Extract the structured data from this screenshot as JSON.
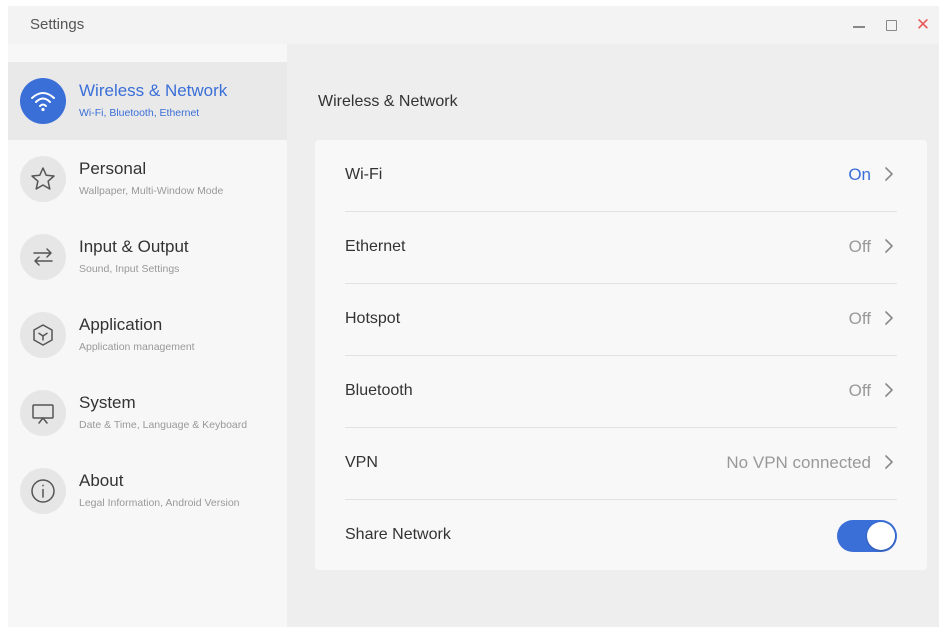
{
  "window": {
    "title": "Settings"
  },
  "sidebar": {
    "items": [
      {
        "title": "Wireless & Network",
        "subtitle": "Wi-Fi, Bluetooth, Ethernet",
        "icon": "wifi-icon",
        "active": true
      },
      {
        "title": "Personal",
        "subtitle": "Wallpaper, Multi-Window Mode",
        "icon": "star-icon",
        "active": false
      },
      {
        "title": "Input & Output",
        "subtitle": "Sound, Input Settings",
        "icon": "swap-arrows-icon",
        "active": false
      },
      {
        "title": "Application",
        "subtitle": "Application management",
        "icon": "cube-icon",
        "active": false
      },
      {
        "title": "System",
        "subtitle": "Date & Time, Language & Keyboard",
        "icon": "monitor-icon",
        "active": false
      },
      {
        "title": "About",
        "subtitle": "Legal Information, Android Version",
        "icon": "info-icon",
        "active": false
      }
    ]
  },
  "main": {
    "title": "Wireless & Network",
    "rows": [
      {
        "label": "Wi-Fi",
        "value": "On"
      },
      {
        "label": "Ethernet",
        "value": "Off"
      },
      {
        "label": "Hotspot",
        "value": "Off"
      },
      {
        "label": "Bluetooth",
        "value": "Off"
      },
      {
        "label": "VPN",
        "value": "No VPN connected"
      },
      {
        "label": "Share Network",
        "toggle": true
      }
    ]
  },
  "colors": {
    "accent": "#3b6fd8",
    "close": "#e85c5c"
  }
}
